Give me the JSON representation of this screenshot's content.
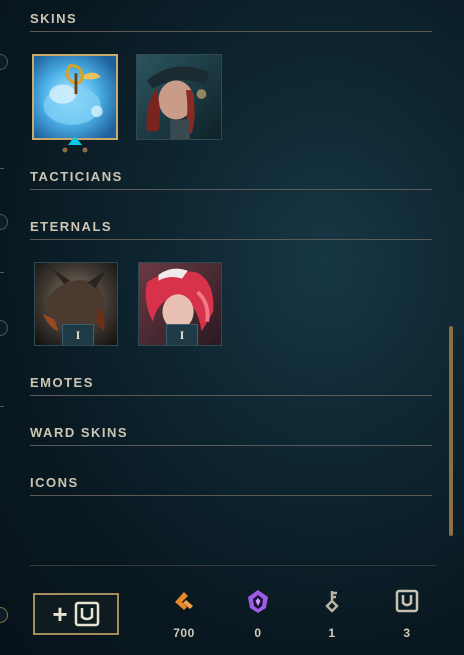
{
  "sections": {
    "skins": "SKINS",
    "tacticians": "TACTICIANS",
    "eternals": "ETERNALS",
    "emotes": "EMOTES",
    "ward_skins": "WARD SKINS",
    "icons": "ICONS"
  },
  "eternals_items": [
    {
      "level": "I"
    },
    {
      "level": "I"
    }
  ],
  "currencies": [
    {
      "icon": "orange-essence-icon",
      "value": "700"
    },
    {
      "icon": "mythic-essence-icon",
      "value": "0"
    },
    {
      "icon": "key-icon",
      "value": "1"
    },
    {
      "icon": "chest-icon",
      "value": "3"
    }
  ],
  "colors": {
    "gold": "#c8aa6e",
    "selection_pointer": "#0ac8e8",
    "orange_essence": "#e8862a",
    "mythic_essence": "#9b5de5"
  }
}
